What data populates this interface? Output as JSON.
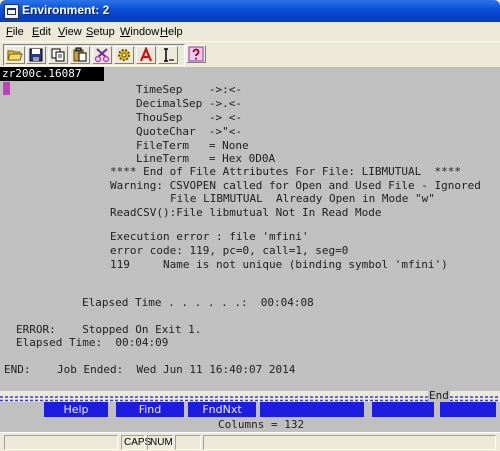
{
  "window": {
    "title": "Environment: 2"
  },
  "menu": [
    {
      "id": "file",
      "accel": "F",
      "rest": "ile"
    },
    {
      "id": "edit",
      "accel": "E",
      "rest": "dit"
    },
    {
      "id": "view",
      "accel": "V",
      "rest": "iew"
    },
    {
      "id": "setup",
      "accel": "S",
      "rest": "etup"
    },
    {
      "id": "window",
      "accel": "W",
      "rest": "indow"
    },
    {
      "id": "help",
      "accel": "H",
      "rest": "elp"
    }
  ],
  "toolbar": {
    "buttons": [
      {
        "icon": "open-folder-icon"
      },
      {
        "icon": "save-disk-icon"
      },
      {
        "icon": "copy-icon"
      },
      {
        "icon": "paste-icon"
      },
      {
        "icon": "cut-scissors-icon"
      },
      {
        "icon": "font-icon"
      },
      {
        "icon": "text-cursor-icon"
      },
      {
        "icon": "help-question-icon"
      }
    ]
  },
  "terminal": {
    "session": "zr200c.16087",
    "lines": [
      "TimeSep    ->:<-",
      "DecimalSep ->.<-",
      "ThouSep    -> <-",
      "QuoteChar  ->\"<-",
      "FileTerm   = None",
      "LineTerm   = Hex 0D0A",
      "**** End of File Attributes For File: LIBMUTUAL  ****",
      "Warning: CSVOPEN called for Open and Used File - Ignored",
      "File LIBMUTUAL  Already Open in Mode \"w\"",
      "ReadCSV():File libmutual Not In Read Mode",
      "Execution error : file 'mfini'",
      "error code: 119, pc=0, call=1, seg=0",
      "119     Name is not unique (binding symbol 'mfini')",
      "Elapsed Time . . . . . .:  00:04:08",
      "ERROR:    Stopped On Exit 1.",
      "Elapsed Time:  00:04:09",
      "END:    Job Ended:  Wed Jun 11 16:40:07 2014"
    ],
    "end_marker": "End"
  },
  "function_keys": [
    {
      "label": "Help"
    },
    {
      "label": "Find"
    },
    {
      "label": "FndNxt"
    },
    {
      "label": ""
    },
    {
      "label": ""
    },
    {
      "label": ""
    }
  ],
  "columns_text": "Columns = 132",
  "status": {
    "caps": "CAPS",
    "num": "NUM"
  },
  "colors": {
    "title_blue": "#0a4fd6",
    "terminal_bg": "#c0c0c0",
    "fkey_blue": "#1d1de0",
    "divider_blue": "#3a3ad8"
  }
}
